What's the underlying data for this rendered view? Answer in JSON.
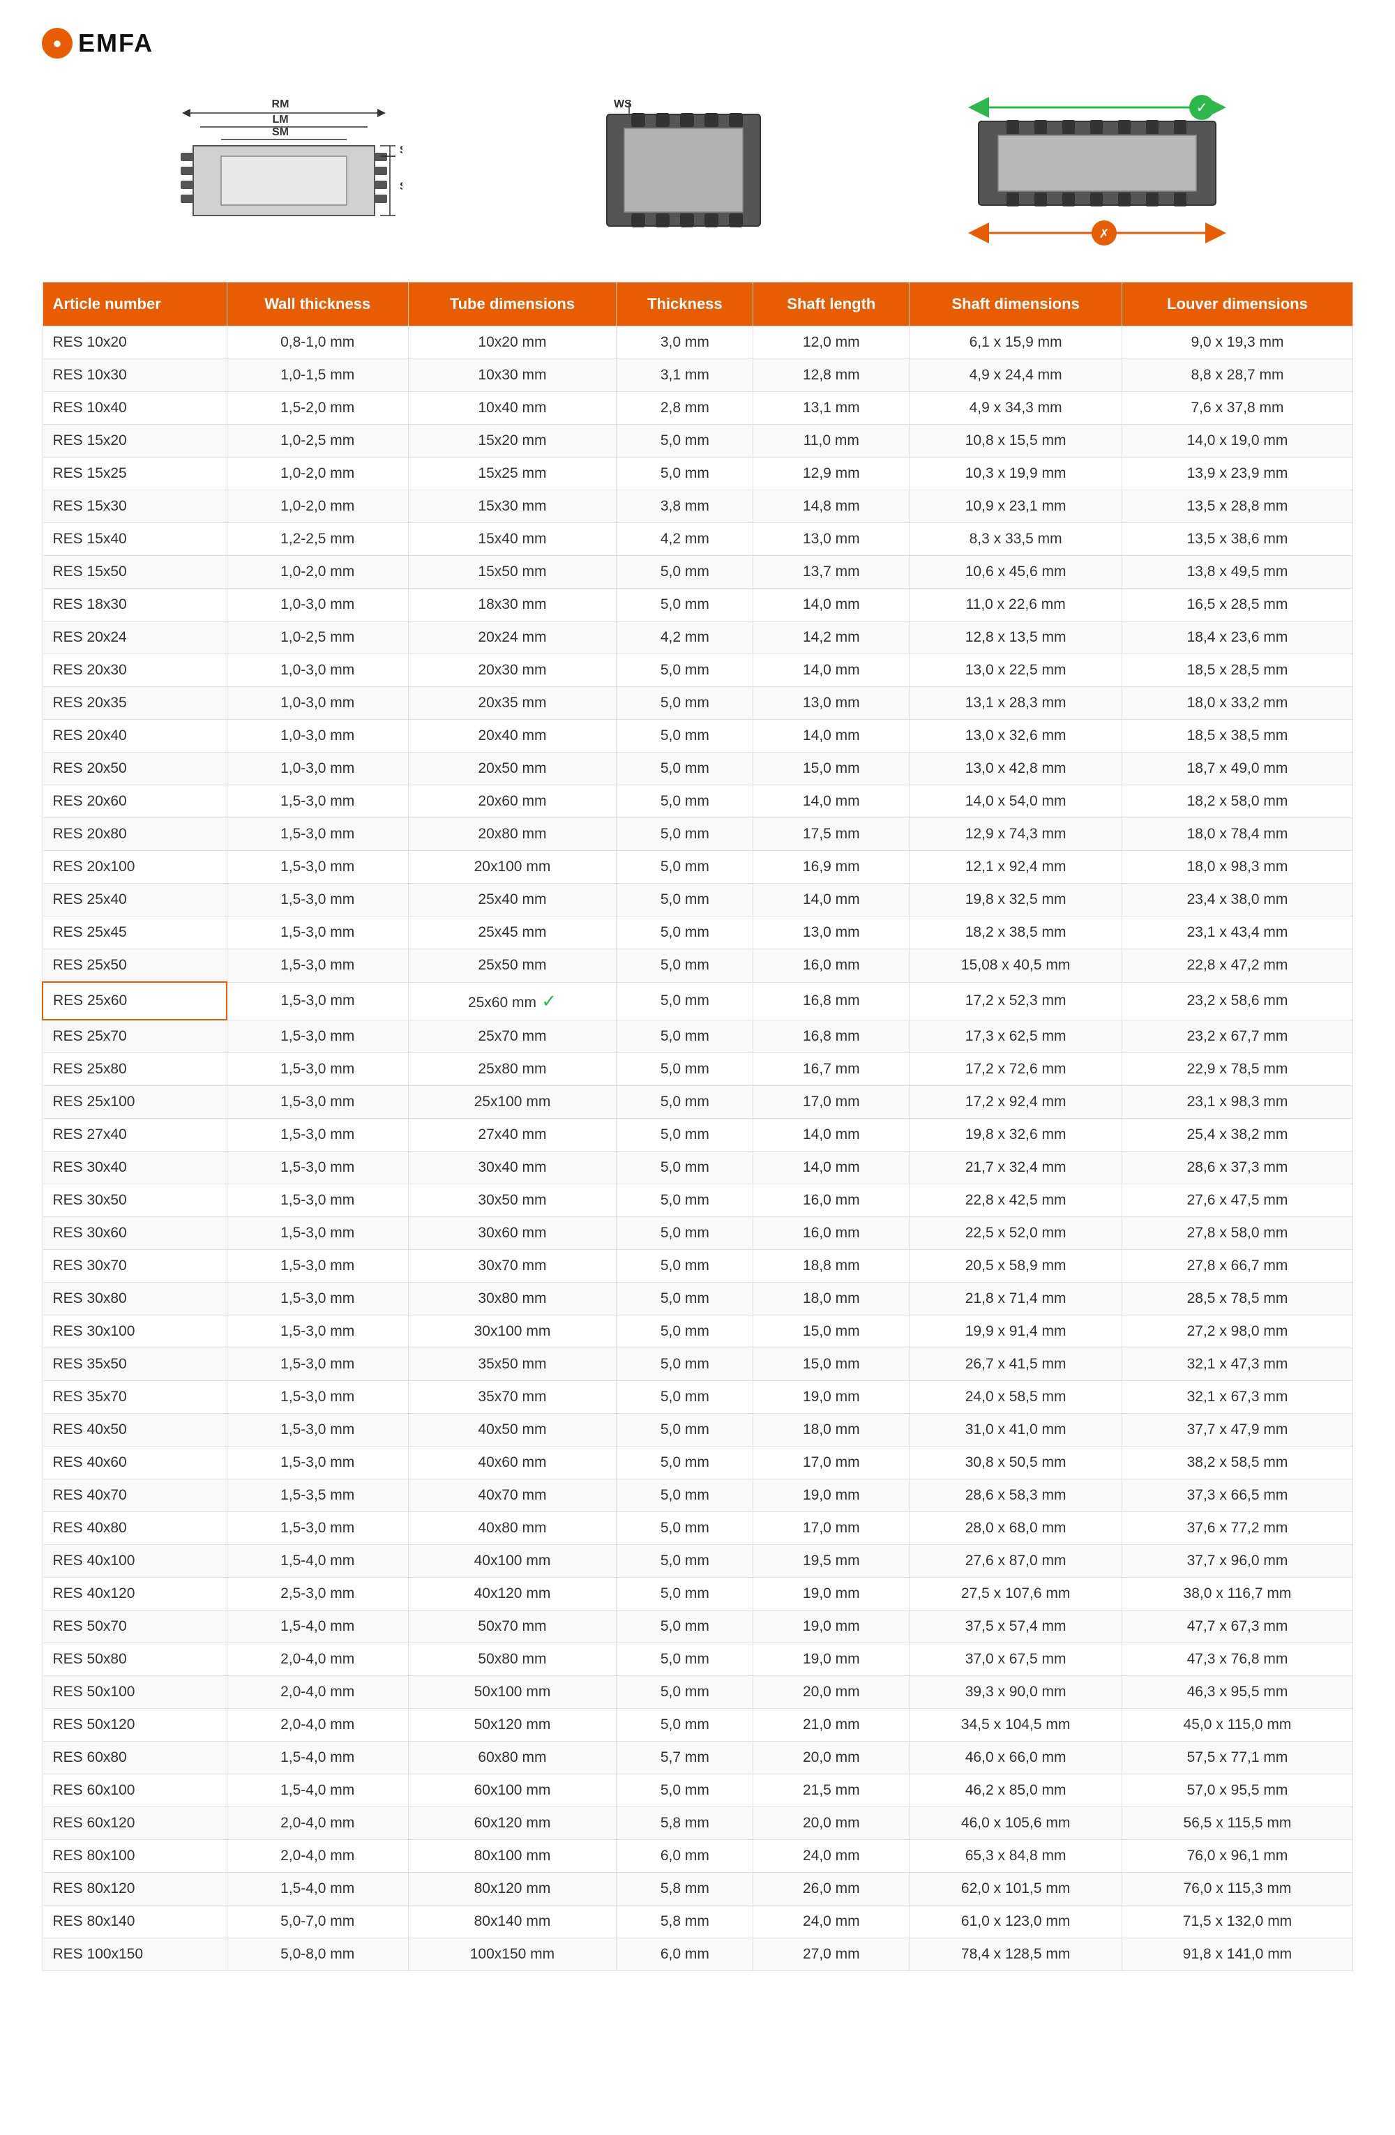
{
  "logo": {
    "symbol": "●",
    "brand": "EMFA"
  },
  "headers": {
    "article_number": "Article number",
    "wall_thickness": "Wall thickness",
    "tube_dimensions": "Tube dimensions",
    "thickness": "Thickness",
    "shaft_length": "Shaft length",
    "shaft_dimensions": "Shaft dimensions",
    "louver_dimensions": "Louver dimensions"
  },
  "diagram_labels": {
    "rm": "RM",
    "lm": "LM",
    "sm": "SM",
    "sk": "SK",
    "se": "SE",
    "ws": "WS"
  },
  "rows": [
    {
      "article": "RES 10x20",
      "wall": "0,8-1,0 mm",
      "tube": "10x20 mm",
      "thickness": "3,0 mm",
      "shaft_len": "12,0 mm",
      "shaft_dim": "6,1 x 15,9 mm",
      "louver": "9,0 x 19,3 mm",
      "highlight": false,
      "check": false
    },
    {
      "article": "RES 10x30",
      "wall": "1,0-1,5 mm",
      "tube": "10x30 mm",
      "thickness": "3,1 mm",
      "shaft_len": "12,8 mm",
      "shaft_dim": "4,9 x 24,4 mm",
      "louver": "8,8 x 28,7 mm",
      "highlight": false,
      "check": false
    },
    {
      "article": "RES 10x40",
      "wall": "1,5-2,0 mm",
      "tube": "10x40 mm",
      "thickness": "2,8 mm",
      "shaft_len": "13,1 mm",
      "shaft_dim": "4,9 x 34,3 mm",
      "louver": "7,6 x 37,8 mm",
      "highlight": false,
      "check": false
    },
    {
      "article": "RES 15x20",
      "wall": "1,0-2,5 mm",
      "tube": "15x20 mm",
      "thickness": "5,0 mm",
      "shaft_len": "11,0 mm",
      "shaft_dim": "10,8 x 15,5 mm",
      "louver": "14,0 x 19,0 mm",
      "highlight": false,
      "check": false
    },
    {
      "article": "RES 15x25",
      "wall": "1,0-2,0 mm",
      "tube": "15x25 mm",
      "thickness": "5,0 mm",
      "shaft_len": "12,9 mm",
      "shaft_dim": "10,3 x 19,9 mm",
      "louver": "13,9 x 23,9 mm",
      "highlight": false,
      "check": false
    },
    {
      "article": "RES 15x30",
      "wall": "1,0-2,0 mm",
      "tube": "15x30 mm",
      "thickness": "3,8 mm",
      "shaft_len": "14,8 mm",
      "shaft_dim": "10,9 x 23,1 mm",
      "louver": "13,5 x 28,8 mm",
      "highlight": false,
      "check": false
    },
    {
      "article": "RES 15x40",
      "wall": "1,2-2,5 mm",
      "tube": "15x40 mm",
      "thickness": "4,2 mm",
      "shaft_len": "13,0 mm",
      "shaft_dim": "8,3 x 33,5 mm",
      "louver": "13,5 x 38,6 mm",
      "highlight": false,
      "check": false
    },
    {
      "article": "RES 15x50",
      "wall": "1,0-2,0 mm",
      "tube": "15x50 mm",
      "thickness": "5,0 mm",
      "shaft_len": "13,7 mm",
      "shaft_dim": "10,6 x 45,6 mm",
      "louver": "13,8 x 49,5 mm",
      "highlight": false,
      "check": false
    },
    {
      "article": "RES 18x30",
      "wall": "1,0-3,0 mm",
      "tube": "18x30 mm",
      "thickness": "5,0 mm",
      "shaft_len": "14,0 mm",
      "shaft_dim": "11,0 x 22,6 mm",
      "louver": "16,5 x 28,5 mm",
      "highlight": false,
      "check": false
    },
    {
      "article": "RES 20x24",
      "wall": "1,0-2,5 mm",
      "tube": "20x24 mm",
      "thickness": "4,2 mm",
      "shaft_len": "14,2 mm",
      "shaft_dim": "12,8 x 13,5 mm",
      "louver": "18,4 x 23,6 mm",
      "highlight": false,
      "check": false
    },
    {
      "article": "RES 20x30",
      "wall": "1,0-3,0 mm",
      "tube": "20x30 mm",
      "thickness": "5,0 mm",
      "shaft_len": "14,0 mm",
      "shaft_dim": "13,0 x 22,5 mm",
      "louver": "18,5 x 28,5 mm",
      "highlight": false,
      "check": false
    },
    {
      "article": "RES 20x35",
      "wall": "1,0-3,0 mm",
      "tube": "20x35 mm",
      "thickness": "5,0 mm",
      "shaft_len": "13,0 mm",
      "shaft_dim": "13,1 x 28,3 mm",
      "louver": "18,0 x 33,2 mm",
      "highlight": false,
      "check": false
    },
    {
      "article": "RES 20x40",
      "wall": "1,0-3,0 mm",
      "tube": "20x40 mm",
      "thickness": "5,0 mm",
      "shaft_len": "14,0 mm",
      "shaft_dim": "13,0 x 32,6 mm",
      "louver": "18,5 x 38,5 mm",
      "highlight": false,
      "check": false
    },
    {
      "article": "RES 20x50",
      "wall": "1,0-3,0 mm",
      "tube": "20x50 mm",
      "thickness": "5,0 mm",
      "shaft_len": "15,0 mm",
      "shaft_dim": "13,0 x 42,8 mm",
      "louver": "18,7 x 49,0 mm",
      "highlight": false,
      "check": false
    },
    {
      "article": "RES 20x60",
      "wall": "1,5-3,0 mm",
      "tube": "20x60 mm",
      "thickness": "5,0 mm",
      "shaft_len": "14,0 mm",
      "shaft_dim": "14,0 x 54,0 mm",
      "louver": "18,2 x 58,0 mm",
      "highlight": false,
      "check": false
    },
    {
      "article": "RES 20x80",
      "wall": "1,5-3,0 mm",
      "tube": "20x80 mm",
      "thickness": "5,0 mm",
      "shaft_len": "17,5 mm",
      "shaft_dim": "12,9 x 74,3 mm",
      "louver": "18,0 x 78,4 mm",
      "highlight": false,
      "check": false
    },
    {
      "article": "RES 20x100",
      "wall": "1,5-3,0 mm",
      "tube": "20x100 mm",
      "thickness": "5,0 mm",
      "shaft_len": "16,9 mm",
      "shaft_dim": "12,1 x 92,4 mm",
      "louver": "18,0 x 98,3 mm",
      "highlight": false,
      "check": false
    },
    {
      "article": "RES 25x40",
      "wall": "1,5-3,0 mm",
      "tube": "25x40 mm",
      "thickness": "5,0 mm",
      "shaft_len": "14,0 mm",
      "shaft_dim": "19,8 x 32,5 mm",
      "louver": "23,4 x 38,0 mm",
      "highlight": false,
      "check": false
    },
    {
      "article": "RES 25x45",
      "wall": "1,5-3,0 mm",
      "tube": "25x45 mm",
      "thickness": "5,0 mm",
      "shaft_len": "13,0 mm",
      "shaft_dim": "18,2 x 38,5 mm",
      "louver": "23,1 x 43,4 mm",
      "highlight": false,
      "check": false
    },
    {
      "article": "RES 25x50",
      "wall": "1,5-3,0 mm",
      "tube": "25x50 mm",
      "thickness": "5,0 mm",
      "shaft_len": "16,0 mm",
      "shaft_dim": "15,08 x 40,5 mm",
      "louver": "22,8 x 47,2 mm",
      "highlight": false,
      "check": false
    },
    {
      "article": "RES 25x60",
      "wall": "1,5-3,0 mm",
      "tube": "25x60 mm",
      "thickness": "5,0 mm",
      "shaft_len": "16,8 mm",
      "shaft_dim": "17,2 x 52,3 mm",
      "louver": "23,2 x 58,6 mm",
      "highlight": true,
      "check": true
    },
    {
      "article": "RES 25x70",
      "wall": "1,5-3,0 mm",
      "tube": "25x70 mm",
      "thickness": "5,0 mm",
      "shaft_len": "16,8 mm",
      "shaft_dim": "17,3 x 62,5 mm",
      "louver": "23,2 x 67,7 mm",
      "highlight": false,
      "check": false
    },
    {
      "article": "RES 25x80",
      "wall": "1,5-3,0 mm",
      "tube": "25x80 mm",
      "thickness": "5,0 mm",
      "shaft_len": "16,7 mm",
      "shaft_dim": "17,2 x 72,6 mm",
      "louver": "22,9 x 78,5 mm",
      "highlight": false,
      "check": false
    },
    {
      "article": "RES 25x100",
      "wall": "1,5-3,0 mm",
      "tube": "25x100 mm",
      "thickness": "5,0 mm",
      "shaft_len": "17,0 mm",
      "shaft_dim": "17,2 x 92,4 mm",
      "louver": "23,1 x 98,3 mm",
      "highlight": false,
      "check": false
    },
    {
      "article": "RES 27x40",
      "wall": "1,5-3,0 mm",
      "tube": "27x40 mm",
      "thickness": "5,0 mm",
      "shaft_len": "14,0 mm",
      "shaft_dim": "19,8 x 32,6 mm",
      "louver": "25,4 x 38,2 mm",
      "highlight": false,
      "check": false
    },
    {
      "article": "RES 30x40",
      "wall": "1,5-3,0 mm",
      "tube": "30x40 mm",
      "thickness": "5,0 mm",
      "shaft_len": "14,0 mm",
      "shaft_dim": "21,7 x 32,4 mm",
      "louver": "28,6 x 37,3 mm",
      "highlight": false,
      "check": false
    },
    {
      "article": "RES 30x50",
      "wall": "1,5-3,0 mm",
      "tube": "30x50 mm",
      "thickness": "5,0 mm",
      "shaft_len": "16,0 mm",
      "shaft_dim": "22,8 x 42,5 mm",
      "louver": "27,6 x 47,5 mm",
      "highlight": false,
      "check": false
    },
    {
      "article": "RES 30x60",
      "wall": "1,5-3,0 mm",
      "tube": "30x60 mm",
      "thickness": "5,0 mm",
      "shaft_len": "16,0 mm",
      "shaft_dim": "22,5 x 52,0 mm",
      "louver": "27,8 x 58,0 mm",
      "highlight": false,
      "check": false
    },
    {
      "article": "RES 30x70",
      "wall": "1,5-3,0 mm",
      "tube": "30x70 mm",
      "thickness": "5,0 mm",
      "shaft_len": "18,8 mm",
      "shaft_dim": "20,5 x 58,9 mm",
      "louver": "27,8 x 66,7 mm",
      "highlight": false,
      "check": false
    },
    {
      "article": "RES 30x80",
      "wall": "1,5-3,0 mm",
      "tube": "30x80 mm",
      "thickness": "5,0 mm",
      "shaft_len": "18,0 mm",
      "shaft_dim": "21,8 x 71,4 mm",
      "louver": "28,5 x 78,5 mm",
      "highlight": false,
      "check": false
    },
    {
      "article": "RES 30x100",
      "wall": "1,5-3,0 mm",
      "tube": "30x100 mm",
      "thickness": "5,0 mm",
      "shaft_len": "15,0 mm",
      "shaft_dim": "19,9 x 91,4 mm",
      "louver": "27,2 x 98,0 mm",
      "highlight": false,
      "check": false
    },
    {
      "article": "RES 35x50",
      "wall": "1,5-3,0 mm",
      "tube": "35x50 mm",
      "thickness": "5,0 mm",
      "shaft_len": "15,0 mm",
      "shaft_dim": "26,7 x 41,5 mm",
      "louver": "32,1 x 47,3 mm",
      "highlight": false,
      "check": false
    },
    {
      "article": "RES 35x70",
      "wall": "1,5-3,0 mm",
      "tube": "35x70 mm",
      "thickness": "5,0 mm",
      "shaft_len": "19,0 mm",
      "shaft_dim": "24,0 x 58,5 mm",
      "louver": "32,1 x 67,3 mm",
      "highlight": false,
      "check": false
    },
    {
      "article": "RES 40x50",
      "wall": "1,5-3,0 mm",
      "tube": "40x50 mm",
      "thickness": "5,0 mm",
      "shaft_len": "18,0 mm",
      "shaft_dim": "31,0 x 41,0 mm",
      "louver": "37,7 x 47,9 mm",
      "highlight": false,
      "check": false
    },
    {
      "article": "RES 40x60",
      "wall": "1,5-3,0 mm",
      "tube": "40x60 mm",
      "thickness": "5,0 mm",
      "shaft_len": "17,0 mm",
      "shaft_dim": "30,8 x 50,5 mm",
      "louver": "38,2 x 58,5 mm",
      "highlight": false,
      "check": false
    },
    {
      "article": "RES 40x70",
      "wall": "1,5-3,5 mm",
      "tube": "40x70 mm",
      "thickness": "5,0 mm",
      "shaft_len": "19,0 mm",
      "shaft_dim": "28,6 x 58,3 mm",
      "louver": "37,3 x 66,5 mm",
      "highlight": false,
      "check": false
    },
    {
      "article": "RES 40x80",
      "wall": "1,5-3,0 mm",
      "tube": "40x80 mm",
      "thickness": "5,0 mm",
      "shaft_len": "17,0 mm",
      "shaft_dim": "28,0 x 68,0 mm",
      "louver": "37,6 x 77,2 mm",
      "highlight": false,
      "check": false
    },
    {
      "article": "RES 40x100",
      "wall": "1,5-4,0 mm",
      "tube": "40x100 mm",
      "thickness": "5,0 mm",
      "shaft_len": "19,5 mm",
      "shaft_dim": "27,6 x 87,0 mm",
      "louver": "37,7 x 96,0 mm",
      "highlight": false,
      "check": false
    },
    {
      "article": "RES 40x120",
      "wall": "2,5-3,0 mm",
      "tube": "40x120 mm",
      "thickness": "5,0 mm",
      "shaft_len": "19,0 mm",
      "shaft_dim": "27,5 x 107,6 mm",
      "louver": "38,0 x 116,7 mm",
      "highlight": false,
      "check": false
    },
    {
      "article": "RES 50x70",
      "wall": "1,5-4,0 mm",
      "tube": "50x70 mm",
      "thickness": "5,0 mm",
      "shaft_len": "19,0 mm",
      "shaft_dim": "37,5 x 57,4 mm",
      "louver": "47,7 x 67,3 mm",
      "highlight": false,
      "check": false
    },
    {
      "article": "RES 50x80",
      "wall": "2,0-4,0 mm",
      "tube": "50x80 mm",
      "thickness": "5,0 mm",
      "shaft_len": "19,0 mm",
      "shaft_dim": "37,0 x 67,5 mm",
      "louver": "47,3 x 76,8 mm",
      "highlight": false,
      "check": false
    },
    {
      "article": "RES 50x100",
      "wall": "2,0-4,0 mm",
      "tube": "50x100 mm",
      "thickness": "5,0 mm",
      "shaft_len": "20,0 mm",
      "shaft_dim": "39,3 x 90,0 mm",
      "louver": "46,3 x 95,5 mm",
      "highlight": false,
      "check": false
    },
    {
      "article": "RES 50x120",
      "wall": "2,0-4,0 mm",
      "tube": "50x120 mm",
      "thickness": "5,0 mm",
      "shaft_len": "21,0 mm",
      "shaft_dim": "34,5 x 104,5 mm",
      "louver": "45,0 x 115,0 mm",
      "highlight": false,
      "check": false
    },
    {
      "article": "RES 60x80",
      "wall": "1,5-4,0 mm",
      "tube": "60x80 mm",
      "thickness": "5,7 mm",
      "shaft_len": "20,0 mm",
      "shaft_dim": "46,0 x 66,0 mm",
      "louver": "57,5 x 77,1 mm",
      "highlight": false,
      "check": false
    },
    {
      "article": "RES 60x100",
      "wall": "1,5-4,0 mm",
      "tube": "60x100 mm",
      "thickness": "5,0 mm",
      "shaft_len": "21,5 mm",
      "shaft_dim": "46,2 x 85,0 mm",
      "louver": "57,0 x 95,5 mm",
      "highlight": false,
      "check": false
    },
    {
      "article": "RES 60x120",
      "wall": "2,0-4,0 mm",
      "tube": "60x120 mm",
      "thickness": "5,8 mm",
      "shaft_len": "20,0 mm",
      "shaft_dim": "46,0 x 105,6 mm",
      "louver": "56,5 x 115,5 mm",
      "highlight": false,
      "check": false
    },
    {
      "article": "RES 80x100",
      "wall": "2,0-4,0 mm",
      "tube": "80x100 mm",
      "thickness": "6,0 mm",
      "shaft_len": "24,0 mm",
      "shaft_dim": "65,3 x 84,8 mm",
      "louver": "76,0 x 96,1 mm",
      "highlight": false,
      "check": false
    },
    {
      "article": "RES 80x120",
      "wall": "1,5-4,0 mm",
      "tube": "80x120 mm",
      "thickness": "5,8 mm",
      "shaft_len": "26,0 mm",
      "shaft_dim": "62,0 x 101,5 mm",
      "louver": "76,0 x 115,3 mm",
      "highlight": false,
      "check": false
    },
    {
      "article": "RES 80x140",
      "wall": "5,0-7,0 mm",
      "tube": "80x140 mm",
      "thickness": "5,8 mm",
      "shaft_len": "24,0 mm",
      "shaft_dim": "61,0 x 123,0 mm",
      "louver": "71,5 x 132,0 mm",
      "highlight": false,
      "check": false
    },
    {
      "article": "RES 100x150",
      "wall": "5,0-8,0 mm",
      "tube": "100x150 mm",
      "thickness": "6,0 mm",
      "shaft_len": "27,0 mm",
      "shaft_dim": "78,4 x 128,5 mm",
      "louver": "91,8 x 141,0 mm",
      "highlight": false,
      "check": false
    }
  ]
}
